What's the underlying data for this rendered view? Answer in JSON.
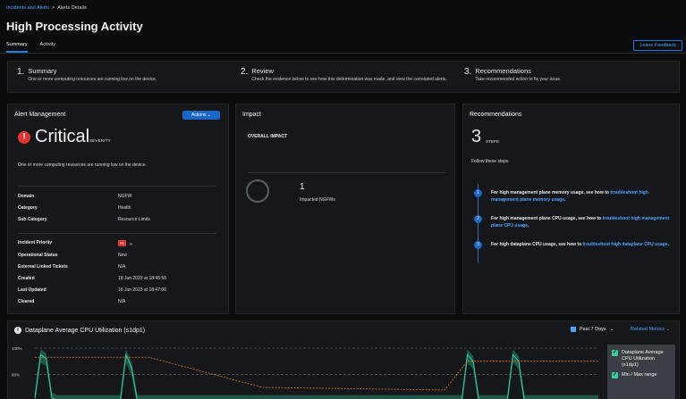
{
  "breadcrumb": {
    "parent": "Incidents and Alerts",
    "separator": ">",
    "current": "Alerts Details"
  },
  "page": {
    "title": "High Processing Activity"
  },
  "tabs": [
    {
      "label": "Summary",
      "active": true
    },
    {
      "label": "Activity",
      "active": false
    }
  ],
  "feedback_label": "Leave Feedback",
  "steps": [
    {
      "num": "1.",
      "title": "Summary",
      "desc": "One or more computing resources are running low on the device."
    },
    {
      "num": "2.",
      "title": "Review",
      "desc": "Check the evidence below to see how this determination was made, and view the correlated alerts."
    },
    {
      "num": "3.",
      "title": "Recommendations",
      "desc": "Take recommended action to fix your issue."
    }
  ],
  "alert": {
    "title": "Alert Management",
    "actions_label": "Actions",
    "severity": "Critical",
    "severity_label": "SEVERITY",
    "description": "One or more computing resources are running low on the device.",
    "details": [
      {
        "k": "Domain",
        "v": "NGFW"
      },
      {
        "k": "Category",
        "v": "Health"
      },
      {
        "k": "Sub Category",
        "v": "Resource Limits"
      }
    ],
    "incident_priority_label": "Incident Priority",
    "incident_priority_value": "P1",
    "status": [
      {
        "k": "Operational Status",
        "v": "New"
      },
      {
        "k": "External Linked Tickets",
        "v": "N/A"
      },
      {
        "k": "Created",
        "v": "18 Jun 2023 at 18:45:56"
      },
      {
        "k": "Last Updated",
        "v": "18 Jun 2023 at 18:47:06"
      },
      {
        "k": "Cleared",
        "v": "N/A"
      }
    ],
    "colors": {
      "critical": "#e03535"
    }
  },
  "impact": {
    "title": "Impact",
    "overall_label": "OVERALL IMPACT",
    "count": "1",
    "count_label": "Impacted NGFWs"
  },
  "recommendations": {
    "title": "Recommendations",
    "count": "3",
    "count_label": "STEPS",
    "follow": "Follow these steps",
    "items": [
      {
        "n": "1",
        "text": "For high management plane memory usage, see how to ",
        "link": "troubleshoot high management plane memory usage",
        "end": "."
      },
      {
        "n": "2",
        "text": "For high management plane CPU usage, see how to ",
        "link": "troubleshoot high management plane CPU usage",
        "end": "."
      },
      {
        "n": "3",
        "text": "For high dataplane CPU usage, see how to ",
        "link": "troubleshoot high dataplane CPU usage",
        "end": "."
      }
    ]
  },
  "chart": {
    "title": "Dataplane Average CPU Utilization (s1dp1)",
    "range_label": "Past 7 Days",
    "related_label": "Related Metrics",
    "legend": [
      "Dataplane Average CPU Utilization (s1dp1)",
      "Min / Max range"
    ],
    "y_ticks": [
      "100%",
      "80%",
      "60%"
    ],
    "colors": {
      "line": "#3bd0a0",
      "band": "#2a8c73",
      "threshold": "#e07b2a"
    }
  },
  "chart_data": {
    "type": "area",
    "title": "Dataplane Average CPU Utilization (s1dp1)",
    "ylabel": "",
    "ylim": [
      55,
      100
    ],
    "y_ticks": [
      100,
      80,
      60
    ],
    "series": [
      {
        "name": "Dataplane Average CPU Utilization (s1dp1)",
        "values": [
          62,
          95,
          92,
          62,
          60,
          60,
          60,
          60,
          60,
          60,
          60,
          60,
          60,
          60,
          60,
          60,
          95,
          85,
          60,
          60,
          60,
          60,
          60,
          60,
          60,
          60,
          60,
          60,
          60,
          60,
          60,
          60,
          60,
          60,
          60,
          60,
          60,
          60,
          60,
          60,
          60,
          60,
          60,
          60,
          60,
          60,
          60,
          60,
          60,
          60,
          60,
          60,
          60,
          60,
          60,
          60,
          60,
          60,
          60,
          60,
          60,
          60,
          60,
          60,
          60,
          60,
          60,
          60,
          60,
          60,
          60,
          60,
          60,
          60,
          60,
          60,
          95,
          90,
          60,
          60,
          60,
          60,
          60,
          60,
          95,
          90,
          60,
          60,
          60,
          60,
          60,
          60,
          60,
          60,
          60,
          60,
          60,
          60,
          60,
          60
        ]
      },
      {
        "name": "Min / Max range",
        "values": []
      }
    ]
  }
}
